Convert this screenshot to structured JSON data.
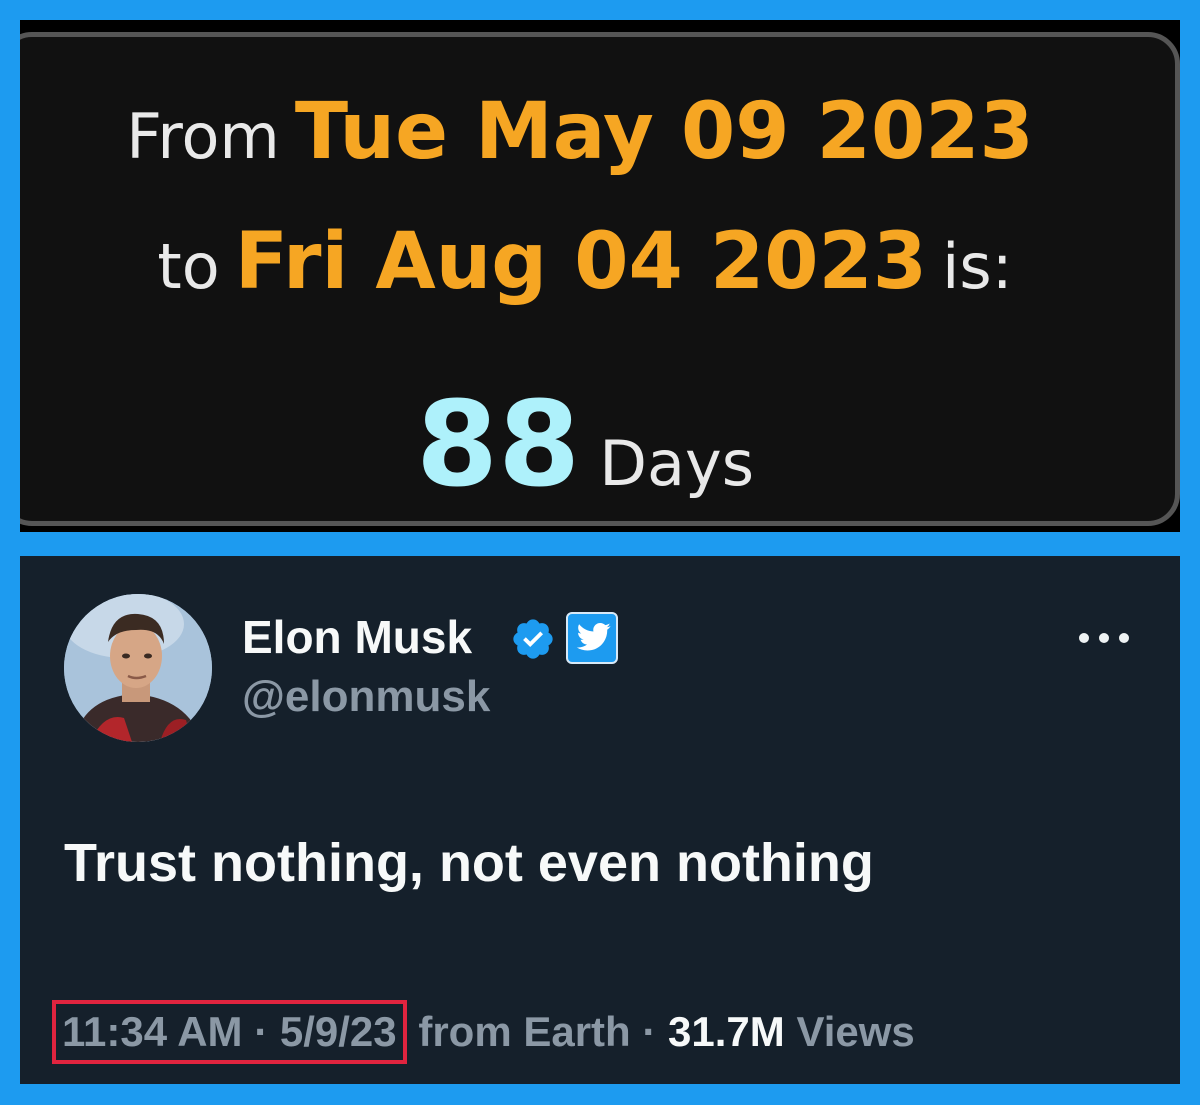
{
  "date_calculator": {
    "from_word": "From",
    "start_date": "Tue May 09 2023",
    "to_word": "to",
    "end_date": "Fri Aug 04 2023",
    "is_word": "is:",
    "result_value": "88",
    "result_unit": "Days",
    "colors": {
      "date": "#f6a623",
      "number": "#aef1fb",
      "text": "#e9e9e9"
    }
  },
  "tweet": {
    "author_name": "Elon Musk",
    "author_handle": "@elonmusk",
    "badges": [
      "verified-icon",
      "twitter-badge-icon"
    ],
    "more_options_icon": "more-options-icon",
    "text": "Trust nothing, not even nothing",
    "time": "11:34 AM",
    "separator": "·",
    "date": "5/9/23",
    "source": "from Earth",
    "views_count": "31.7M",
    "views_label": "Views",
    "colors": {
      "background": "#15202b",
      "highlight_box": "#e0243f",
      "accent": "#1d9bf0"
    }
  }
}
